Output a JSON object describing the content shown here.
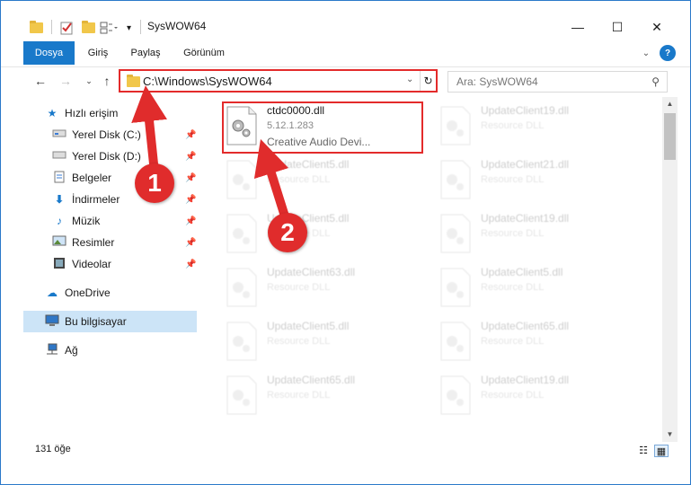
{
  "window": {
    "title": "SysWOW64"
  },
  "ribbon": {
    "tabs": [
      "Dosya",
      "Giriş",
      "Paylaş",
      "Görünüm"
    ]
  },
  "address": {
    "path": "C:\\Windows\\SysWOW64"
  },
  "search": {
    "placeholder": "Ara: SysWOW64"
  },
  "sidebar": {
    "quick_access": "Hızlı erişim",
    "items": [
      {
        "label": "Yerel Disk (C:)",
        "icon": "drive-icon",
        "pinned": true
      },
      {
        "label": "Yerel Disk (D:)",
        "icon": "drive-icon",
        "pinned": true
      },
      {
        "label": "Belgeler",
        "icon": "document-icon",
        "pinned": true
      },
      {
        "label": "İndirmeler",
        "icon": "download-icon",
        "pinned": true
      },
      {
        "label": "Müzik",
        "icon": "music-icon",
        "pinned": true
      },
      {
        "label": "Resimler",
        "icon": "pictures-icon",
        "pinned": true
      },
      {
        "label": "Videolar",
        "icon": "video-icon",
        "pinned": true
      }
    ],
    "onedrive": "OneDrive",
    "this_pc": "Bu bilgisayar",
    "network": "Ağ"
  },
  "files": [
    {
      "name": "ctdc0000.dll",
      "meta": "5.12.1.283",
      "desc": "Creative Audio Devi...",
      "highlighted": true
    },
    {
      "name": "UpdateClient19.dll",
      "meta": "Resource DLL"
    },
    {
      "name": "UpdateClient5.dll",
      "meta": "Resource DLL"
    },
    {
      "name": "UpdateClient21.dll",
      "meta": "Resource DLL"
    },
    {
      "name": "UpdateClient5.dll",
      "meta": "Resource DLL"
    },
    {
      "name": "UpdateClient19.dll",
      "meta": "Resource DLL"
    },
    {
      "name": "UpdateClient63.dll",
      "meta": "Resource DLL"
    },
    {
      "name": "UpdateClient5.dll",
      "meta": "Resource DLL"
    },
    {
      "name": "UpdateClient5.dll",
      "meta": "Resource DLL"
    },
    {
      "name": "UpdateClient65.dll",
      "meta": "Resource DLL"
    },
    {
      "name": "UpdateClient65.dll",
      "meta": "Resource DLL"
    },
    {
      "name": "UpdateClient19.dll",
      "meta": "Resource DLL"
    }
  ],
  "status": {
    "count": "131 öğe"
  },
  "annotations": {
    "step1": "1",
    "step2": "2",
    "color": "#e02c2c"
  }
}
